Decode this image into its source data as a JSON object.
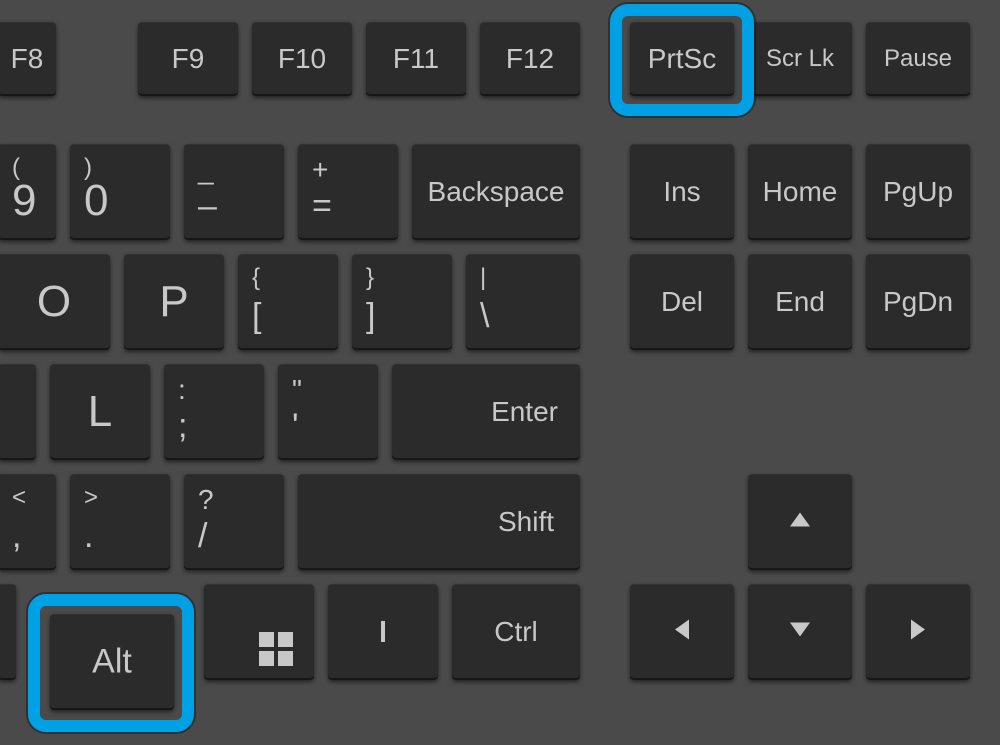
{
  "highlighted_keys": [
    "prtsc",
    "alt"
  ],
  "row1": {
    "f8": "F8",
    "f9": "F9",
    "f10": "F10",
    "f11": "F11",
    "f12": "F12",
    "prtsc": "PrtSc",
    "scrlk": "Scr Lk",
    "pause": "Pause"
  },
  "row2": {
    "nine": {
      "upper": "(",
      "lower": "9"
    },
    "zero": {
      "upper": ")",
      "lower": "0"
    },
    "minus": {
      "upper": "_",
      "lower": "–"
    },
    "equals": {
      "upper": "+",
      "lower": "="
    },
    "backspace": "Backspace",
    "ins": "Ins",
    "home": "Home",
    "pgup": "PgUp"
  },
  "row3": {
    "o": "O",
    "p": "P",
    "lbracket": {
      "upper": "{",
      "lower": "["
    },
    "rbracket": {
      "upper": "}",
      "lower": "]"
    },
    "backslash": {
      "upper": "|",
      "lower": "\\"
    },
    "del": "Del",
    "end": "End",
    "pgdn": "PgDn"
  },
  "row4": {
    "l": "L",
    "semicolon": {
      "upper": ":",
      "lower": ";"
    },
    "quote": {
      "upper": "\"",
      "lower": "'"
    },
    "enter": "Enter"
  },
  "row5": {
    "comma": {
      "upper": "<",
      "lower": ","
    },
    "period": {
      "upper": ">",
      "lower": "."
    },
    "slash": {
      "upper": "?",
      "lower": "/"
    },
    "shift": "Shift"
  },
  "row6": {
    "alt": "Alt",
    "ctrl": "Ctrl"
  },
  "icons": {
    "windows_key": "windows-logo-icon",
    "menu_key": "menu-icon",
    "arrow_up": "arrow-up-icon",
    "arrow_down": "arrow-down-icon",
    "arrow_left": "arrow-left-icon",
    "arrow_right": "arrow-right-icon"
  }
}
